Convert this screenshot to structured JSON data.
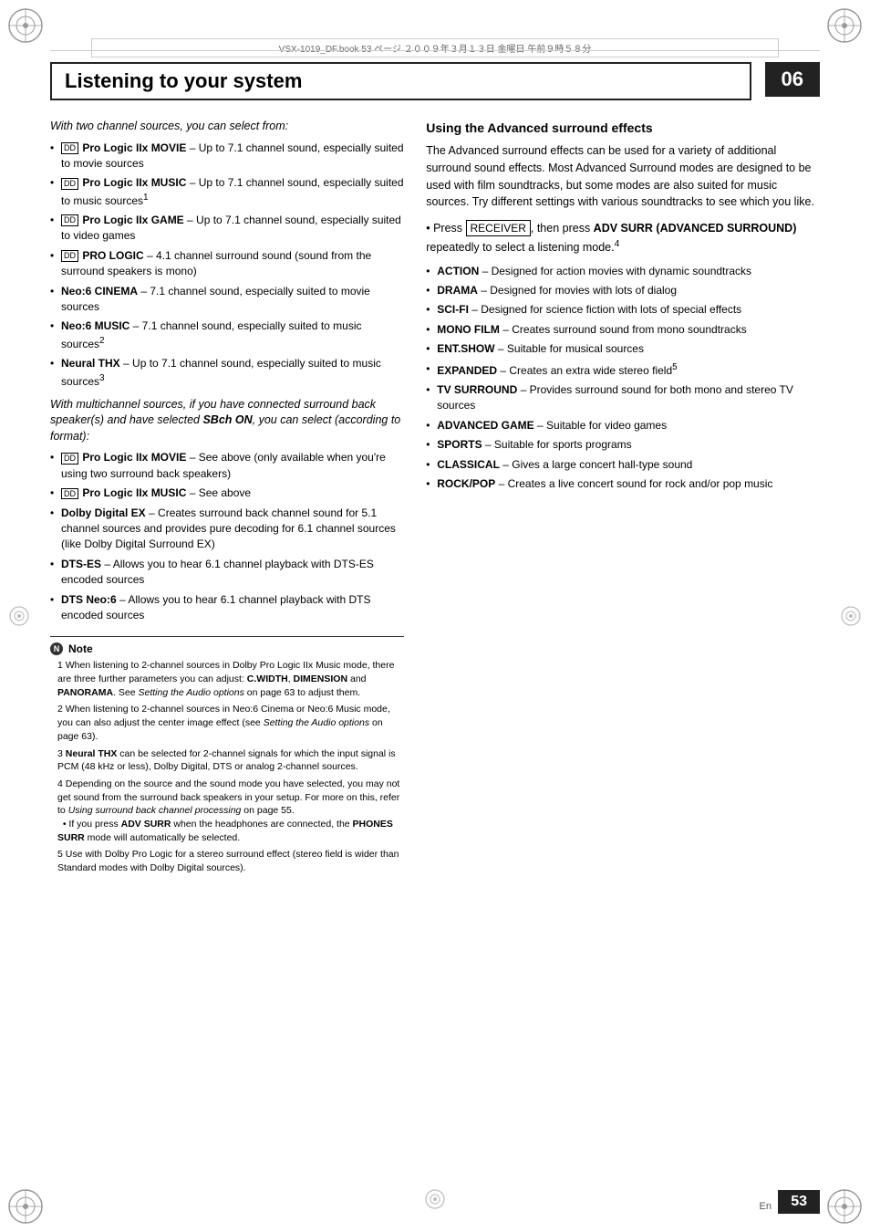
{
  "file_info": "VSX-1019_DF.book  53 ページ  ２００９年３月１３日  金曜日  午前９時５８分",
  "chapter": "06",
  "page_title": "Listening to your system",
  "page_number": "53",
  "page_locale": "En",
  "left_col": {
    "intro_two_channel": "With two channel sources, you can select from:",
    "two_channel_items": [
      {
        "prefix_icon": true,
        "label": "Pro Logic IIx MOVIE",
        "text": " – Up to 7.1 channel sound, especially suited to movie sources"
      },
      {
        "prefix_icon": true,
        "label": "Pro Logic IIx MUSIC",
        "text": " – Up to 7.1 channel sound, especially suited to music sources",
        "sup": "1"
      },
      {
        "prefix_icon": true,
        "label": "Pro Logic IIx GAME",
        "text": " – Up to 7.1 channel sound, especially suited to video games"
      },
      {
        "prefix_icon": true,
        "label": "PRO LOGIC",
        "text": " – 4.1 channel surround sound (sound from the surround speakers is mono)"
      },
      {
        "prefix_icon": false,
        "label": "Neo:6 CINEMA",
        "text": " – 7.1 channel sound, especially suited to movie sources"
      },
      {
        "prefix_icon": false,
        "label": "Neo:6 MUSIC",
        "text": " – 7.1 channel sound, especially suited to music sources",
        "sup": "2"
      },
      {
        "prefix_icon": false,
        "label": "Neural THX",
        "text": " – Up to 7.1 channel sound, especially suited to music sources",
        "sup": "3"
      }
    ],
    "intro_multichannel": "With multichannel sources, if you have connected surround back speaker(s) and have selected SBch ON, you can select (according to format):",
    "multi_channel_items": [
      {
        "prefix_icon": true,
        "label": "Pro Logic IIx MOVIE",
        "text": " – See above (only available when you're using two surround back speakers)"
      },
      {
        "prefix_icon": true,
        "label": "Pro Logic IIx MUSIC",
        "text": " – See above"
      },
      {
        "prefix_icon": false,
        "label": "Dolby Digital EX",
        "text": " – Creates surround back channel sound for 5.1 channel sources and provides pure decoding for 6.1 channel sources (like Dolby Digital Surround EX)"
      },
      {
        "prefix_icon": false,
        "label": "DTS-ES",
        "text": " – Allows you to hear 6.1 channel playback with DTS-ES encoded sources"
      },
      {
        "prefix_icon": false,
        "label": "DTS Neo:6",
        "text": " – Allows you to hear 6.1 channel playback with DTS encoded sources"
      }
    ]
  },
  "right_col": {
    "section_title": "Using the Advanced surround effects",
    "intro": "The Advanced surround effects can be used for a variety of additional surround sound effects. Most Advanced Surround modes are designed to be used with film soundtracks, but some modes are also suited for music sources. Try different settings with various soundtracks to see which you like.",
    "instruction": "Press RECEIVER, then press ADV SURR (ADVANCED SURROUND) repeatedly to select a listening mode.",
    "instruction_sup": "4",
    "receiver_btn_label": "RECEIVER",
    "advanced_items": [
      {
        "label": "ACTION",
        "text": " – Designed for action movies with dynamic soundtracks"
      },
      {
        "label": "DRAMA",
        "text": " – Designed for movies with lots of dialog"
      },
      {
        "label": "SCI-FI",
        "text": " – Designed for science fiction with lots of special effects"
      },
      {
        "label": "MONO FILM",
        "text": " – Creates surround sound from mono soundtracks"
      },
      {
        "label": "ENT.SHOW",
        "text": " – Suitable for musical sources"
      },
      {
        "label": "EXPANDED",
        "text": " – Creates an extra wide stereo field",
        "sup": "5"
      },
      {
        "label": "TV SURROUND",
        "text": " – Provides surround sound for both mono and stereo TV sources"
      },
      {
        "label": "ADVANCED GAME",
        "text": " – Suitable for video games"
      },
      {
        "label": "SPORTS",
        "text": " – Suitable for sports programs"
      },
      {
        "label": "CLASSICAL",
        "text": " – Gives a large concert hall-type sound"
      },
      {
        "label": "ROCK/POP",
        "text": " – Creates a live concert sound for rock and/or pop music"
      }
    ]
  },
  "notes": {
    "header": "Note",
    "items": [
      "1 When listening to 2-channel sources in Dolby Pro Logic IIx Music mode, there are three further parameters you can adjust: C.WIDTH, DIMENSION and PANORAMA. See Setting the Audio options on page 63 to adjust them.",
      "2 When listening to 2-channel sources in Neo:6 Cinema or Neo:6 Music mode, you can also adjust the center image effect (see Setting the Audio options on page 63).",
      "3 Neural THX can be selected for 2-channel signals for which the input signal is PCM (48 kHz or less), Dolby Digital, DTS or analog 2-channel sources.",
      "4 Depending on the source and the sound mode you have selected, you may not get sound from the surround back speakers in your setup. For more on this, refer to Using surround back channel processing on page 55.\n  • If you press ADV SURR when the headphones are connected, the PHONES SURR mode will automatically be selected.",
      "5 Use with Dolby Pro Logic for a stereo surround effect (stereo field is wider than Standard modes with Dolby Digital sources)."
    ]
  }
}
